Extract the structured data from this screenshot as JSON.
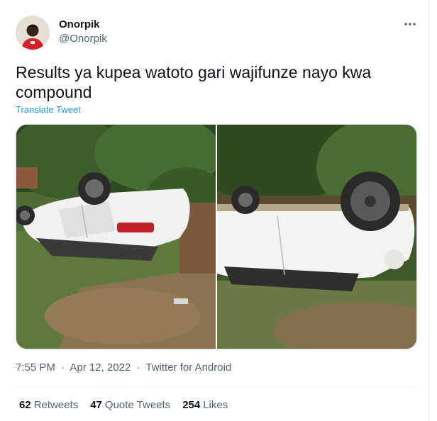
{
  "user": {
    "name": "Onorpik",
    "handle": "@Onorpik"
  },
  "more_icon": "ellipsis-icon",
  "tweet": {
    "text": "Results ya kupea watoto gari wajifunze nayo kwa compound",
    "translate_label": "Translate Tweet"
  },
  "media": {
    "photo_1": "overturned white car on grass (left photo)",
    "photo_2": "overturned white car on grass (right photo)"
  },
  "meta": {
    "time": "7:55 PM",
    "sep1": "·",
    "date": "Apr 12, 2022",
    "sep2": "·",
    "source": "Twitter for Android"
  },
  "stats": {
    "retweets_count": "62",
    "retweets_label": "Retweets",
    "quotes_count": "47",
    "quotes_label": "Quote Tweets",
    "likes_count": "254",
    "likes_label": "Likes"
  },
  "colors": {
    "link": "#1d9bf0",
    "secondary_text": "#536471",
    "primary_text": "#0f1419"
  }
}
